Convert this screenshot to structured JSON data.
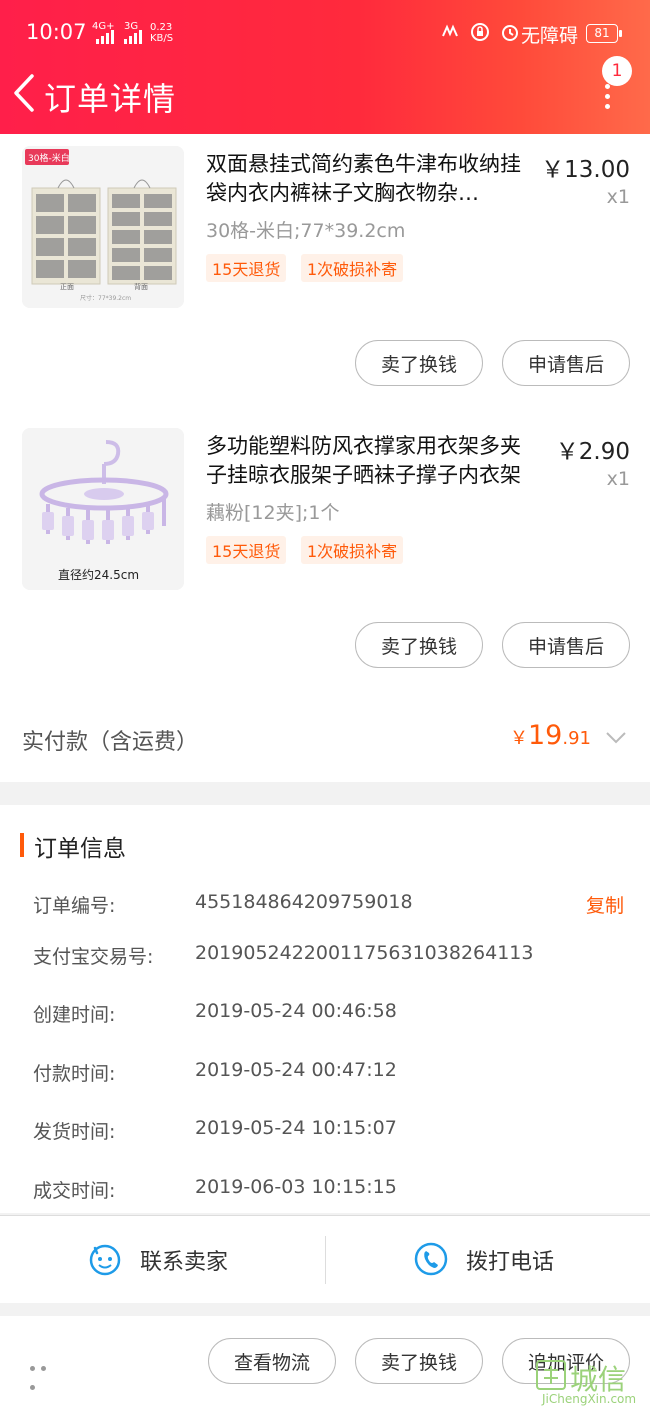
{
  "status_bar": {
    "time": "10:07",
    "sig1": "4G+",
    "sig2": "3G",
    "net_speed_value": "0.23",
    "net_speed_unit": "KB/S",
    "accessibility_label": "无障碍",
    "battery": "81"
  },
  "nav": {
    "title": "订单详情",
    "badge": "1"
  },
  "products": [
    {
      "image_label": "30格-米白",
      "image_caption1": "正面",
      "image_caption2": "背面",
      "image_size": "尺寸：77*39.2cm",
      "title": "双面悬挂式简约素色牛津布收纳挂袋内衣内裤袜子文胸衣物杂…",
      "price": "￥13.00",
      "qty": "x1",
      "sku": "30格-米白;77*39.2cm",
      "tags": [
        "15天退货",
        "1次破损补寄"
      ],
      "buttons": [
        "卖了换钱",
        "申请售后"
      ]
    },
    {
      "image_caption": "直径约24.5cm",
      "title": "多功能塑料防风衣撑家用衣架多夹子挂晾衣服架子晒袜子撑子内衣架",
      "price": "￥2.90",
      "qty": "x1",
      "sku": "藕粉[12夹];1个",
      "tags": [
        "15天退货",
        "1次破损补寄"
      ],
      "buttons": [
        "卖了换钱",
        "申请售后"
      ]
    }
  ],
  "payment": {
    "label": "实付款（含运费）",
    "currency": "￥",
    "amount_int": "19",
    "amount_dec": ".91"
  },
  "order_info": {
    "title": "订单信息",
    "copy_label": "复制",
    "rows": [
      {
        "key": "订单编号:",
        "value": "455184864209759018"
      },
      {
        "key": "支付宝交易号:",
        "value": "2019052422001175631038264113"
      },
      {
        "key": "创建时间:",
        "value": "2019-05-24 00:46:58"
      },
      {
        "key": "付款时间:",
        "value": "2019-05-24 00:47:12"
      },
      {
        "key": "发货时间:",
        "value": "2019-05-24 10:15:07"
      },
      {
        "key": "成交时间:",
        "value": "2019-06-03 10:15:15"
      }
    ]
  },
  "contact": {
    "seller_label": "联系卖家",
    "phone_label": "拨打电话"
  },
  "bottom": {
    "buttons": [
      "查看物流",
      "卖了换钱",
      "追加评价"
    ]
  },
  "watermark": {
    "text": "城信",
    "sub": "JiChengXin.com"
  },
  "colors": {
    "brand_red": "#ff2a3c",
    "accent_orange": "#ff5a0a",
    "tag_bg": "#fff1e8",
    "icon_blue": "#1e9be8"
  }
}
